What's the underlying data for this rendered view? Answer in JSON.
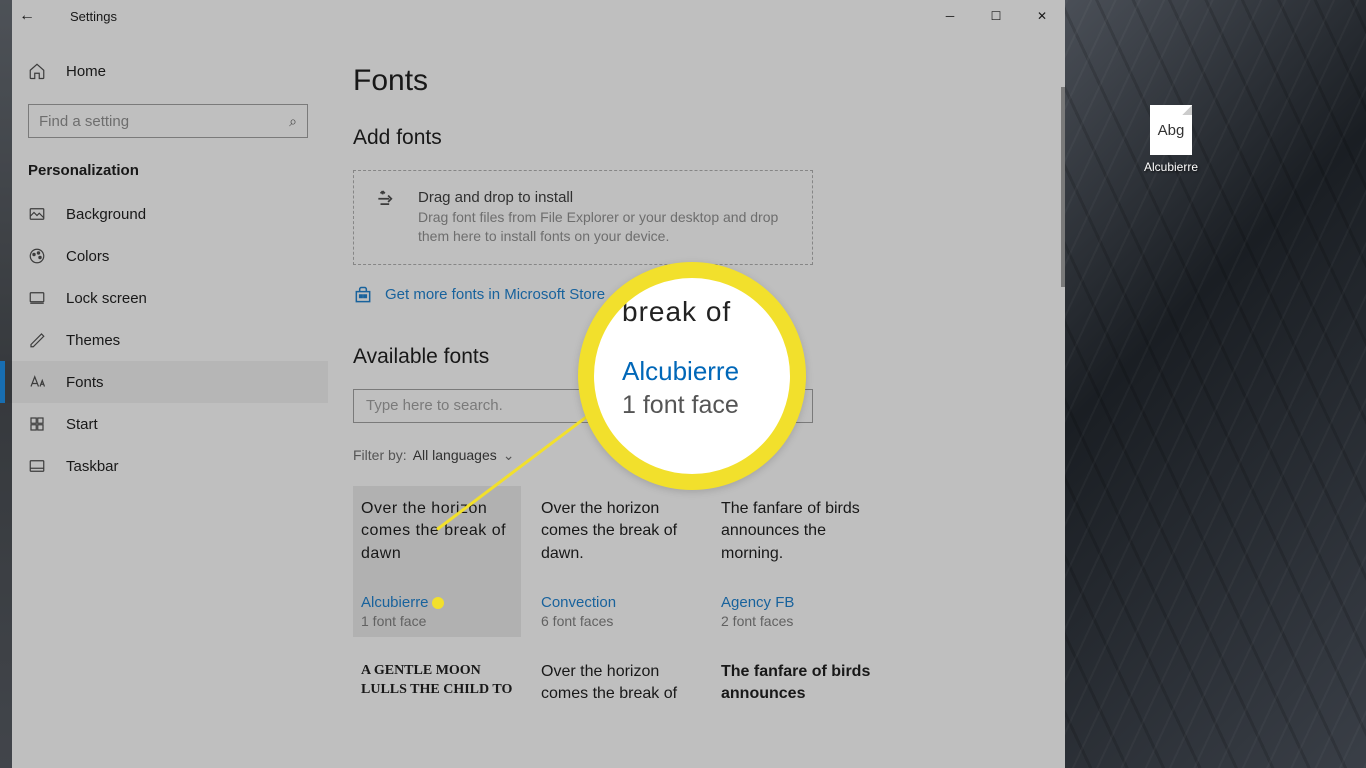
{
  "window": {
    "title": "Settings",
    "minimize": "─",
    "maximize": "☐",
    "close": "✕",
    "back": "←"
  },
  "sidebar": {
    "home": "Home",
    "search_placeholder": "Find a setting",
    "section": "Personalization",
    "items": [
      {
        "icon": "background",
        "label": "Background"
      },
      {
        "icon": "colors",
        "label": "Colors"
      },
      {
        "icon": "lock",
        "label": "Lock screen"
      },
      {
        "icon": "themes",
        "label": "Themes"
      },
      {
        "icon": "fonts",
        "label": "Fonts",
        "active": true
      },
      {
        "icon": "start",
        "label": "Start"
      },
      {
        "icon": "taskbar",
        "label": "Taskbar"
      }
    ]
  },
  "main": {
    "page_title": "Fonts",
    "add_heading": "Add fonts",
    "drop_title": "Drag and drop to install",
    "drop_sub": "Drag font files from File Explorer or your desktop and drop them here to install fonts on your device.",
    "store_link": "Get more fonts in Microsoft Store",
    "available_heading": "Available fonts",
    "font_search_placeholder": "Type here to search.",
    "filter_label": "Filter by:",
    "filter_value": "All languages"
  },
  "fonts": [
    {
      "name": "Alcubierre",
      "faces": "1 font face",
      "preview": "Over the horizon comes the break of dawn",
      "cls": "preview-alcubierre",
      "hl": true
    },
    {
      "name": "Convection",
      "faces": "6 font faces",
      "preview": "Over the horizon comes the break of dawn.",
      "cls": "preview-convection"
    },
    {
      "name": "Agency FB",
      "faces": "2 font faces",
      "preview": "The fanfare of birds announces the morning.",
      "cls": "preview-agency"
    },
    {
      "name": "",
      "faces": "",
      "preview": "A gentle moon lulls the child to",
      "cls": "preview-decorative"
    },
    {
      "name": "",
      "faces": "",
      "preview": "Over the horizon comes the break of",
      "cls": "preview-convection"
    },
    {
      "name": "",
      "faces": "",
      "preview": "The fanfare of birds announces",
      "cls": "preview-bold"
    }
  ],
  "highlight": {
    "break_text": "break of",
    "name": "Alcubierre",
    "faces": "1 font face"
  },
  "desktop": {
    "file_preview": "Abg",
    "label": "Alcubierre"
  }
}
